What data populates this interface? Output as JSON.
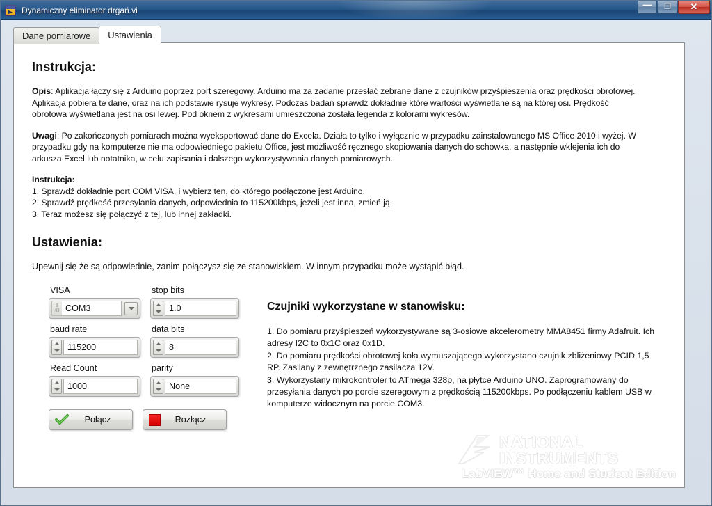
{
  "window": {
    "title": "Dynamiczny eliminator drgań.vi",
    "icon": "labview-vi-icon",
    "buttons": {
      "minimize": "—",
      "restore": "❐",
      "close": "✕"
    }
  },
  "tabs": [
    {
      "label": "Dane pomiarowe",
      "active": false
    },
    {
      "label": "Ustawienia",
      "active": true
    }
  ],
  "instruction": {
    "heading": "Instrukcja:",
    "opis_label": "Opis",
    "opis_text": ": Aplikacja łączy się z Arduino poprzez port szeregowy. Arduino ma za zadanie przesłać zebrane dane z czujników przyśpieszenia oraz prędkości obrotowej. Aplikacja pobiera te dane, oraz na ich podstawie rysuje wykresy. Podczas badań sprawdź dokładnie które wartości wyświetlane są na której osi. Prędkość obrotowa wyświetlana jest na osi lewej. Pod oknem z wykresami umieszczona została legenda z kolorami wykresów.",
    "uwagi_label": "Uwagi",
    "uwagi_text": ": Po zakończonych pomiarach można wyeksportować dane do Excela. Działa to tylko i wyłącznie w przypadku zainstalowanego MS Office 2010 i wyżej. W przypadku gdy na komputerze nie ma odpowiedniego pakietu Office, jest możliwość ręcznego skopiowania danych do schowka, a następnie wklejenia ich do arkusza Excel lub notatnika, w celu zapisania i dalszego wykorzystywania danych pomiarowych.",
    "steps_heading": "Instrukcja:",
    "steps": [
      "1. Sprawdź dokładnie port COM VISA, i wybierz ten, do którego podłączone jest Arduino.",
      "2. Sprawdź prędkość przesyłania danych, odpowiednia to 115200kbps, jeżeli jest inna, zmień ją.",
      "3. Teraz możesz się połączyć z tej, lub innej zakładki."
    ]
  },
  "settings": {
    "heading": "Ustawienia:",
    "lead": "Upewnij się że są odpowiednie, zanim połączysz się ze stanowiskiem. W innym przypadku może wystąpić błąd.",
    "controls": [
      {
        "label": "VISA",
        "value": "COM3",
        "kind": "combo",
        "icon": "io-resource-icon"
      },
      {
        "label": "stop bits",
        "value": "1.0",
        "kind": "spinner"
      },
      {
        "label": "baud rate",
        "value": "115200",
        "kind": "spinner"
      },
      {
        "label": "data bits",
        "value": "8",
        "kind": "spinner"
      },
      {
        "label": "Read Count",
        "value": "1000",
        "kind": "spinner"
      },
      {
        "label": "parity",
        "value": "None",
        "kind": "spinner"
      }
    ],
    "buttons": [
      {
        "label": "Połącz",
        "icon": "green-check-icon",
        "color": "#3fa02c"
      },
      {
        "label": "Rozłącz",
        "icon": "red-stop-icon",
        "color": "#e10000"
      }
    ]
  },
  "sensors": {
    "heading": "Czujniki wykorzystane w stanowisku:",
    "items": [
      "1. Do pomiaru przyśpieszeń wykorzystywane są 3-osiowe akcelerometry MMA8451 firmy Adafruit. Ich adresy I2C to 0x1C oraz 0x1D.",
      "2. Do pomiaru prędkości obrotowej koła wymuszającego wykorzystano czujnik zbliżeniowy PCID 1,5 RP. Zasilany z zewnętrznego zasilacza 12V.",
      "3. Wykorzystany mikrokontroler to ATmega 328p, na płytce Arduino UNO. Zaprogramowany do przesyłania danych po porcie szeregowym z prędkością 115200kbps. Po podłączeniu kablem USB w komputerze widocznym na porcie COM3."
    ]
  },
  "watermark": {
    "line1": "NATIONAL",
    "line2": "INSTRUMENTS",
    "sub": "LabVIEW™ Home and Student Edition",
    "mark": "ni-eagle-logo"
  },
  "colors": {
    "titlebar": "#1f5286",
    "close_button": "#c43a2b",
    "accent_green": "#3fa02c",
    "accent_red": "#e10000",
    "panel_bg": "#ffffff",
    "window_bg": "#dfe6ef"
  }
}
